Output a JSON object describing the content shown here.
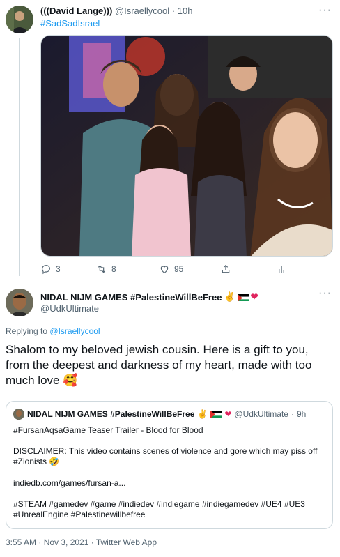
{
  "tweet1": {
    "display_name": "(((David Lange)))",
    "handle": "@Israellycool",
    "time": "10h",
    "hashtag": "#SadSadIsrael",
    "replies": "3",
    "retweets": "8",
    "likes": "95",
    "more_label": "···"
  },
  "tweet2": {
    "display_name": "NIDAL NIJM GAMES #PalestineWillBeFree",
    "handle": "@UdkUltimate",
    "replying_prefix": "Replying to",
    "replying_to": "@Israellycool",
    "text": "Shalom to my beloved jewish cousin. Here is a gift to you, from the deepest and darkness of my heart, made with too much love 🥰",
    "more_label": "···",
    "footer": "3:55 AM · Nov 3, 2021 · Twitter Web App"
  },
  "quote": {
    "display_name": "NIDAL NIJM GAMES #PalestineWillBeFree",
    "handle": "@UdkUltimate",
    "time": "9h",
    "line1": "#FursanAqsaGame Teaser Trailer - Blood for Blood",
    "line2": "DISCLAIMER: This video contains scenes of violence and gore which may piss off #Zionists 🤣",
    "line3": "indiedb.com/games/fursan-a...",
    "line4": "#STEAM #gamedev #game #indiedev #indiegame #indiegamedev #UE4 #UE3 #UnrealEngine #Palestinewillbefree"
  },
  "colors": {
    "accent": "#1d9bf0",
    "muted": "#536471",
    "border": "#cfd9de"
  }
}
